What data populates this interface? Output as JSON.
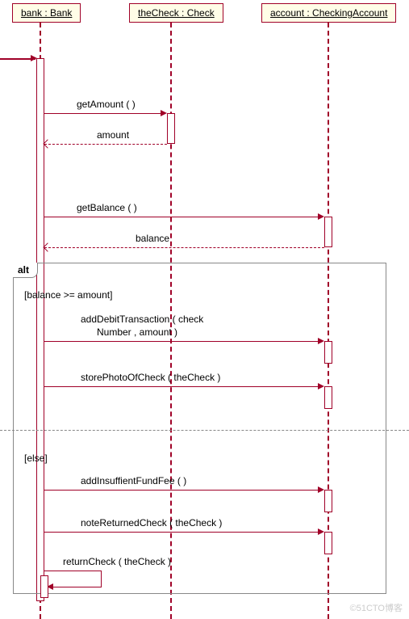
{
  "lifelines": {
    "bank": "bank : Bank",
    "check": "theCheck : Check",
    "account": "account : CheckingAccount"
  },
  "messages": {
    "getAmount": "getAmount ( )",
    "amountReturn": "amount",
    "getBalance": "getBalance ( )",
    "balanceReturn": "balance",
    "addDebit": "addDebitTransaction ( check",
    "addDebit2": "Number , amount )",
    "storePhoto": "storePhotoOfCheck ( theCheck )",
    "addFee": "addInsuffientFundFee ( )",
    "noteReturned": "noteReturnedCheck ( theCheck )",
    "returnCheck": "returnCheck ( theCheck )"
  },
  "fragment": {
    "operator": "alt",
    "guard1": "[balance >= amount]",
    "guard2": "[else]"
  },
  "watermark": "©51CTO博客"
}
